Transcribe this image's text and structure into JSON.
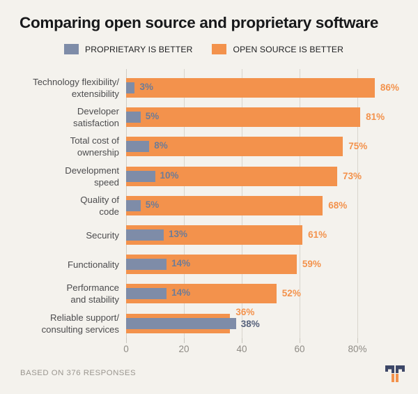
{
  "chart_data": {
    "type": "bar",
    "orientation": "horizontal",
    "overlap": "overlaid",
    "title": "Comparing open source and proprietary software",
    "xlabel": "",
    "ylabel": "",
    "xlim": [
      0,
      90
    ],
    "grid": true,
    "legend_position": "top",
    "categories": [
      "Technology flexibility/ extensibility",
      "Developer satisfaction",
      "Total cost of ownership",
      "Development speed",
      "Quality of code",
      "Security",
      "Functionality",
      "Performance and stability",
      "Reliable support/ consulting services"
    ],
    "category_lines": [
      [
        "Technology flexibility/",
        "extensibility"
      ],
      [
        "Developer",
        "satisfaction"
      ],
      [
        "Total cost of",
        "ownership"
      ],
      [
        "Development",
        "speed"
      ],
      [
        "Quality of",
        "code"
      ],
      [
        "Security"
      ],
      [
        "Functionality"
      ],
      [
        "Performance",
        "and stability"
      ],
      [
        "Reliable support/",
        "consulting services"
      ]
    ],
    "series": [
      {
        "name": "PROPRIETARY IS BETTER",
        "color": "#7e8ca8",
        "values": [
          3,
          5,
          8,
          10,
          5,
          13,
          14,
          14,
          38
        ],
        "labels": [
          "3%",
          "5%",
          "8%",
          "10%",
          "5%",
          "13%",
          "14%",
          "14%",
          "38%"
        ]
      },
      {
        "name": "OPEN SOURCE IS BETTER",
        "color": "#f3924c",
        "values": [
          86,
          81,
          75,
          73,
          68,
          61,
          59,
          52,
          36
        ],
        "labels": [
          "86%",
          "81%",
          "75%",
          "73%",
          "68%",
          "61%",
          "59%",
          "52%",
          "36%"
        ]
      }
    ],
    "xticks": [
      0,
      20,
      40,
      60,
      80
    ],
    "xtick_labels": [
      "0",
      "20",
      "40",
      "60",
      "80%"
    ],
    "annotations": [
      "BASED ON 376 RESPONSES"
    ]
  },
  "legend": {
    "items": [
      {
        "label": "PROPRIETARY IS BETTER",
        "color": "#7e8ca8"
      },
      {
        "label": "OPEN SOURCE IS BETTER",
        "color": "#f3924c"
      }
    ]
  },
  "footer": {
    "note": "BASED ON 376 RESPONSES",
    "logo_name": "tns-logo"
  },
  "colors": {
    "background": "#f4f2ed",
    "proprietary": "#7e8ca8",
    "open_source": "#f3924c",
    "title": "#17181a",
    "grid": "#d8d5cd",
    "axis_text": "#8e8b85",
    "category_text": "#4c4c4e",
    "logo_navy": "#3d4767"
  }
}
